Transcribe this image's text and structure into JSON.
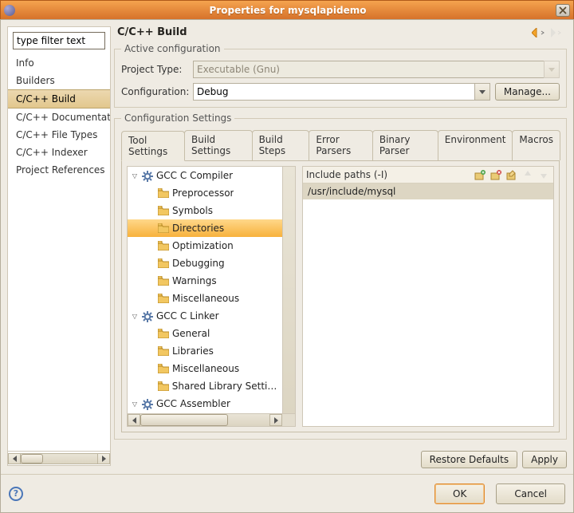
{
  "window": {
    "title": "Properties for mysqlapidemo"
  },
  "sidebar": {
    "filter_placeholder": "type filter text",
    "items": [
      {
        "label": "Info"
      },
      {
        "label": "Builders"
      },
      {
        "label": "C/C++ Build"
      },
      {
        "label": "C/C++ Documentation"
      },
      {
        "label": "C/C++ File Types"
      },
      {
        "label": "C/C++ Indexer"
      },
      {
        "label": "Project References"
      }
    ],
    "selected_index": 2
  },
  "page": {
    "title": "C/C++ Build",
    "active_config": {
      "legend": "Active configuration",
      "project_type_label": "Project Type:",
      "project_type_value": "Executable (Gnu)",
      "configuration_label": "Configuration:",
      "configuration_value": "Debug",
      "manage_label": "Manage..."
    },
    "settings": {
      "legend": "Configuration Settings",
      "tabs": [
        "Tool Settings",
        "Build Settings",
        "Build Steps",
        "Error Parsers",
        "Binary Parser",
        "Environment",
        "Macros"
      ],
      "active_tab": 0,
      "tree": [
        {
          "label": "GCC C Compiler",
          "depth": 0,
          "expanded": true,
          "type": "tool"
        },
        {
          "label": "Preprocessor",
          "depth": 1,
          "type": "opt"
        },
        {
          "label": "Symbols",
          "depth": 1,
          "type": "opt"
        },
        {
          "label": "Directories",
          "depth": 1,
          "type": "opt",
          "selected": true
        },
        {
          "label": "Optimization",
          "depth": 1,
          "type": "opt"
        },
        {
          "label": "Debugging",
          "depth": 1,
          "type": "opt"
        },
        {
          "label": "Warnings",
          "depth": 1,
          "type": "opt"
        },
        {
          "label": "Miscellaneous",
          "depth": 1,
          "type": "opt"
        },
        {
          "label": "GCC C Linker",
          "depth": 0,
          "expanded": true,
          "type": "tool"
        },
        {
          "label": "General",
          "depth": 1,
          "type": "opt"
        },
        {
          "label": "Libraries",
          "depth": 1,
          "type": "opt"
        },
        {
          "label": "Miscellaneous",
          "depth": 1,
          "type": "opt"
        },
        {
          "label": "Shared Library Settings",
          "depth": 1,
          "type": "opt"
        },
        {
          "label": "GCC Assembler",
          "depth": 0,
          "expanded": true,
          "type": "tool"
        }
      ],
      "paths_header": "Include paths (-I)",
      "paths": [
        "/usr/include/mysql"
      ],
      "path_tool_icons": [
        "add-include-icon",
        "delete-include-icon",
        "edit-include-icon",
        "move-up-icon",
        "move-down-icon"
      ]
    },
    "restore_label": "Restore Defaults",
    "apply_label": "Apply"
  },
  "footer": {
    "ok_label": "OK",
    "cancel_label": "Cancel"
  }
}
